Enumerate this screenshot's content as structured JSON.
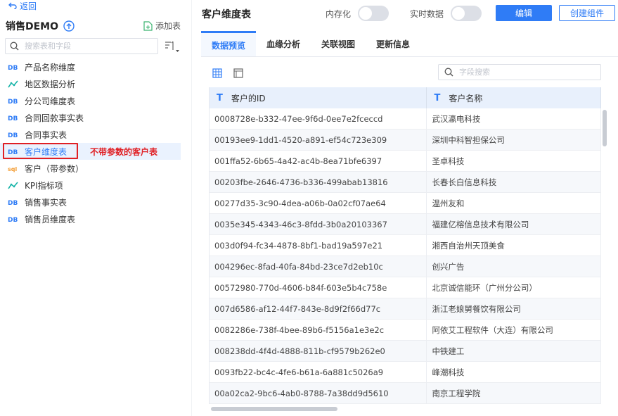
{
  "sidebar": {
    "back_label": "返回",
    "package_title": "销售DEMO",
    "add_table_label": "添加表",
    "search_placeholder": "搜索表和字段",
    "items": [
      {
        "label": "产品名称维度",
        "icon": "db-table-icon"
      },
      {
        "label": "地区数据分析",
        "icon": "analysis-icon"
      },
      {
        "label": "分公司维度表",
        "icon": "db-table-icon"
      },
      {
        "label": "合同回款事实表",
        "icon": "db-table-icon"
      },
      {
        "label": "合同事实表",
        "icon": "db-table-icon"
      },
      {
        "label": "客户维度表",
        "icon": "db-table-icon",
        "selected": true
      },
      {
        "label": "客户（带参数）",
        "icon": "sql-icon"
      },
      {
        "label": "KPI指标项",
        "icon": "analysis-icon"
      },
      {
        "label": "销售事实表",
        "icon": "db-table-icon"
      },
      {
        "label": "销售员维度表",
        "icon": "db-table-icon"
      }
    ],
    "annotation": "不带参数的客户表"
  },
  "header": {
    "title": "客户维度表",
    "in_memory_label": "内存化",
    "realtime_label": "实时数据",
    "edit_button": "编辑",
    "create_component_button": "创建组件"
  },
  "tabs": [
    {
      "label": "数据预览",
      "active": true
    },
    {
      "label": "血缘分析"
    },
    {
      "label": "关联视图"
    },
    {
      "label": "更新信息"
    }
  ],
  "field_search_placeholder": "字段搜索",
  "table": {
    "columns": [
      {
        "type": "T",
        "label": "客户的ID"
      },
      {
        "type": "T",
        "label": "客户名称"
      }
    ],
    "rows": [
      [
        "0008728e-b332-47ee-9f6d-0ee7e2fceccd",
        "武汉瀛电科技"
      ],
      [
        "00193ee9-1dd1-4520-a891-ef54c723e309",
        "深圳中科智担保公司"
      ],
      [
        "001ffa52-6b65-4a42-ac4b-8ea71bfe6397",
        "圣卓科技"
      ],
      [
        "00203fbe-2646-4736-b336-499abab13816",
        "长春长白信息科技"
      ],
      [
        "00277d35-3c90-4dea-a06b-0a02cf07ae64",
        "温州友和"
      ],
      [
        "0035e345-4343-46c3-8fdd-3b0a20103367",
        "福建亿榕信息技术有限公司"
      ],
      [
        "003d0f94-fc34-4878-8bf1-bad19a597e21",
        "湘西自治州天顶美食"
      ],
      [
        "004296ec-8fad-40fa-84bd-23ce7d2eb10c",
        "创兴广告"
      ],
      [
        "00572980-770d-4606-b84f-603e5b4c758e",
        "北京诚信能环（广州分公司）"
      ],
      [
        "007d6586-af12-44f7-843e-8d9f2f66d77c",
        "浙江老娘舅餐饮有限公司"
      ],
      [
        "0082286e-738f-4bee-89b6-f5156a1e3e2c",
        "阿依艾工程软件（大连）有限公司"
      ],
      [
        "008238dd-4f4d-4888-811b-cf9579b262e0",
        "中铁建工"
      ],
      [
        "0093fb22-bc4c-4fe6-b61a-6a881c5026a9",
        "峰潮科技"
      ],
      [
        "00a02ca2-9bc6-4ab0-8788-7a38dd9d5610",
        "南京工程学院"
      ]
    ]
  },
  "colors": {
    "accent": "#2f7cf6",
    "annotation": "#e01f24"
  }
}
